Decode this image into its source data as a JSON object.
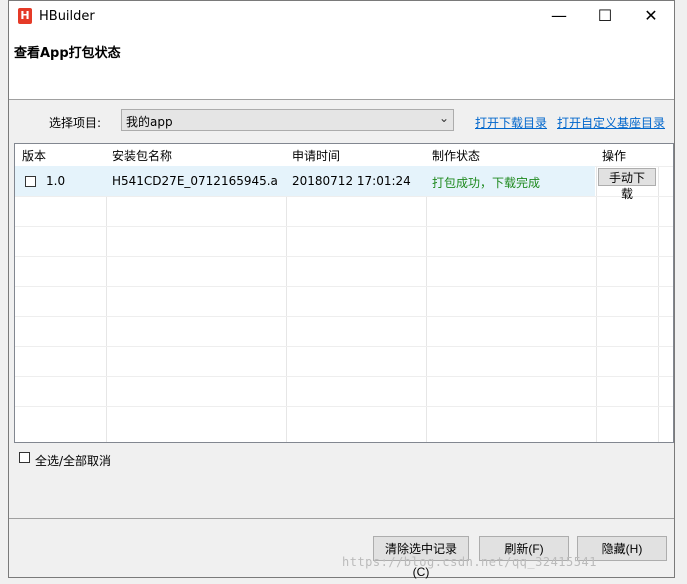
{
  "window": {
    "title": "HBuilder",
    "logo": "H"
  },
  "page_title": "查看App打包状态",
  "project": {
    "label": "选择项目:",
    "value": "我的app",
    "link_download_dir": "打开下载目录",
    "link_custom_dir": "打开自定义基座目录"
  },
  "table": {
    "headers": [
      "版本",
      "安装包名称",
      "申请时间",
      "制作状态",
      "操作"
    ],
    "rows": [
      {
        "version": "1.0",
        "package": "H541CD27E_0712165945.a",
        "time": "20180712 17:01:24",
        "status": "打包成功，下载完成",
        "action": "手动下载"
      }
    ]
  },
  "select_all_label": "全选/全部取消",
  "buttons": {
    "clear": "清除选中记录(C)",
    "refresh": "刷新(F)",
    "hide": "隐藏(H)"
  },
  "watermark": "https://blog.csdn.net/qq_32415541",
  "colors": {
    "status_ok": "#1f8a1f",
    "link": "#0066cc",
    "selected_row": "#e5f3fb"
  }
}
